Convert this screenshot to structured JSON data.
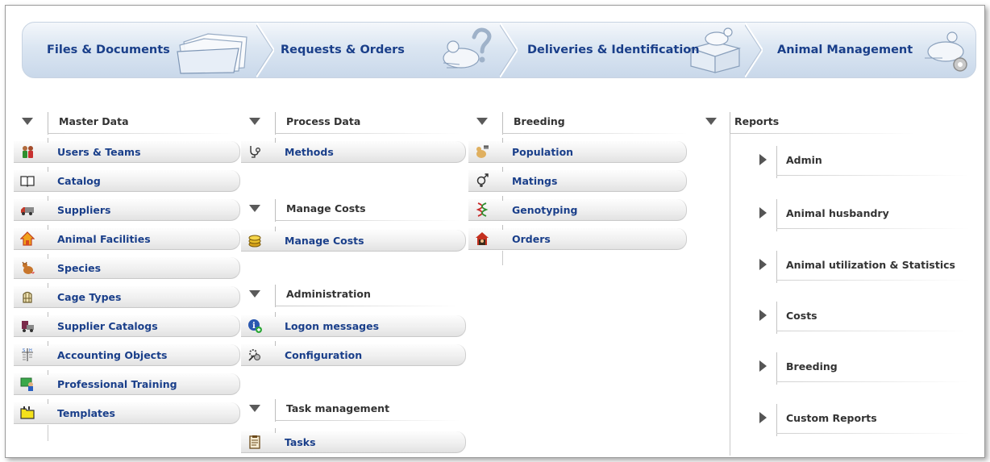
{
  "topnav": {
    "tabs": [
      {
        "label": "Files & Documents",
        "icon": "folder-icon"
      },
      {
        "label": "Requests & Orders",
        "icon": "mouse-question-icon"
      },
      {
        "label": "Deliveries & Identification",
        "icon": "mouse-box-icon"
      },
      {
        "label": "Animal Management",
        "icon": "mouse-gear-icon"
      }
    ]
  },
  "master": {
    "title": "Master Data",
    "items": [
      {
        "label": "Users & Teams",
        "icon": "users-icon"
      },
      {
        "label": "Catalog",
        "icon": "book-icon"
      },
      {
        "label": "Suppliers",
        "icon": "truck-icon"
      },
      {
        "label": "Animal Facilities",
        "icon": "house-icon"
      },
      {
        "label": "Species",
        "icon": "rodent-icon"
      },
      {
        "label": "Cage Types",
        "icon": "cage-icon"
      },
      {
        "label": "Supplier Catalogs",
        "icon": "supplier-catalog-icon"
      },
      {
        "label": "Accounting Objects",
        "icon": "ledger-icon"
      },
      {
        "label": "Professional Training",
        "icon": "training-icon"
      },
      {
        "label": "Templates",
        "icon": "templates-folder-icon"
      }
    ]
  },
  "process": {
    "title": "Process Data",
    "methods": {
      "label": "Methods",
      "icon": "stethoscope-icon"
    },
    "costs_title": "Manage Costs",
    "costs": {
      "label": "Manage Costs",
      "icon": "coins-icon"
    },
    "admin_title": "Administration",
    "admin": [
      {
        "label": "Logon messages",
        "icon": "info-user-icon"
      },
      {
        "label": "Configuration",
        "icon": "configuration-icon"
      }
    ],
    "task_title": "Task management",
    "tasks": {
      "label": "Tasks",
      "icon": "clipboard-icon"
    }
  },
  "breeding": {
    "title": "Breeding",
    "items": [
      {
        "label": "Population",
        "icon": "population-icon"
      },
      {
        "label": "Matings",
        "icon": "gender-icon"
      },
      {
        "label": "Genotyping",
        "icon": "dna-icon"
      },
      {
        "label": "Orders",
        "icon": "orders-icon"
      }
    ]
  },
  "reports": {
    "title": "Reports",
    "items": [
      {
        "label": "Admin"
      },
      {
        "label": "Animal husbandry"
      },
      {
        "label": "Animal utilization & Statistics"
      },
      {
        "label": "Costs"
      },
      {
        "label": "Breeding"
      },
      {
        "label": "Custom Reports"
      }
    ]
  },
  "colors": {
    "link": "#1a3f8a",
    "nav_bg": "#dbe6f2",
    "heading": "#333333"
  }
}
